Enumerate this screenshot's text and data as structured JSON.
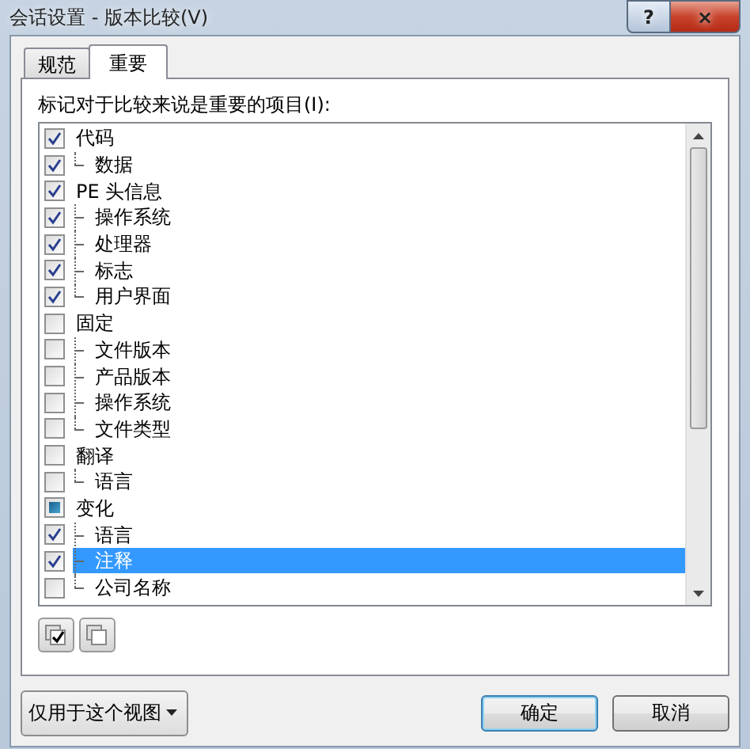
{
  "window": {
    "title": "会话设置 - 版本比较(V)",
    "help": "?",
    "close": "×"
  },
  "tabs": [
    {
      "label": "规范",
      "selected": false
    },
    {
      "label": "重要",
      "selected": true
    }
  ],
  "list_label": "标记对于比较来说是重要的项目(I):",
  "items": [
    {
      "label": "代码",
      "checked": true,
      "partial": false,
      "selected": false,
      "children": [
        {
          "label": "数据",
          "checked": true,
          "selected": false
        }
      ]
    },
    {
      "label": "PE 头信息",
      "checked": true,
      "partial": false,
      "selected": false,
      "children": [
        {
          "label": "操作系统",
          "checked": true,
          "selected": false
        },
        {
          "label": "处理器",
          "checked": true,
          "selected": false
        },
        {
          "label": "标志",
          "checked": true,
          "selected": false
        },
        {
          "label": "用户界面",
          "checked": true,
          "selected": false
        }
      ]
    },
    {
      "label": "固定",
      "checked": false,
      "partial": false,
      "selected": false,
      "children": [
        {
          "label": "文件版本",
          "checked": false,
          "selected": false
        },
        {
          "label": "产品版本",
          "checked": false,
          "selected": false
        },
        {
          "label": "操作系统",
          "checked": false,
          "selected": false
        },
        {
          "label": "文件类型",
          "checked": false,
          "selected": false
        }
      ]
    },
    {
      "label": "翻译",
      "checked": false,
      "partial": false,
      "selected": false,
      "children": [
        {
          "label": "语言",
          "checked": false,
          "selected": false
        }
      ]
    },
    {
      "label": "变化",
      "checked": false,
      "partial": true,
      "selected": false,
      "children": [
        {
          "label": "语言",
          "checked": true,
          "selected": false
        },
        {
          "label": "注释",
          "checked": true,
          "selected": true
        },
        {
          "label": "公司名称",
          "checked": false,
          "selected": false
        }
      ]
    }
  ],
  "scope_dropdown": "仅用于这个视图",
  "buttons": [
    {
      "label": "确定",
      "kind": "default"
    },
    {
      "label": "取消",
      "kind": "normal"
    }
  ]
}
